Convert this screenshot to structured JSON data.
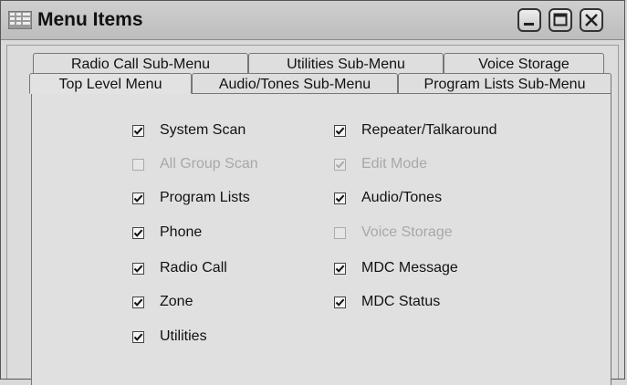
{
  "window": {
    "title": "Menu Items"
  },
  "tabs_back": [
    {
      "label": "Radio Call Sub-Menu"
    },
    {
      "label": "Utilities Sub-Menu"
    },
    {
      "label": "Voice Storage"
    }
  ],
  "tabs_front": [
    {
      "label": "Top Level Menu",
      "active": true
    },
    {
      "label": "Audio/Tones Sub-Menu"
    },
    {
      "label": "Program Lists Sub-Menu"
    }
  ],
  "left_options": [
    {
      "label": "System Scan",
      "checked": true,
      "enabled": true
    },
    {
      "label": "All Group Scan",
      "checked": false,
      "enabled": false
    },
    {
      "label": "Program Lists",
      "checked": true,
      "enabled": true
    },
    {
      "label": "Phone",
      "checked": true,
      "enabled": true
    },
    {
      "label": "Radio Call",
      "checked": true,
      "enabled": true
    },
    {
      "label": "Zone",
      "checked": true,
      "enabled": true
    },
    {
      "label": "Utilities",
      "checked": true,
      "enabled": true
    }
  ],
  "right_options": [
    {
      "label": "Repeater/Talkaround",
      "checked": true,
      "enabled": true
    },
    {
      "label": "Edit Mode",
      "checked": true,
      "enabled": false
    },
    {
      "label": "Audio/Tones",
      "checked": true,
      "enabled": true
    },
    {
      "label": "Voice Storage",
      "checked": false,
      "enabled": false
    },
    {
      "label": "MDC Message",
      "checked": true,
      "enabled": true
    },
    {
      "label": "MDC Status",
      "checked": true,
      "enabled": true
    }
  ]
}
